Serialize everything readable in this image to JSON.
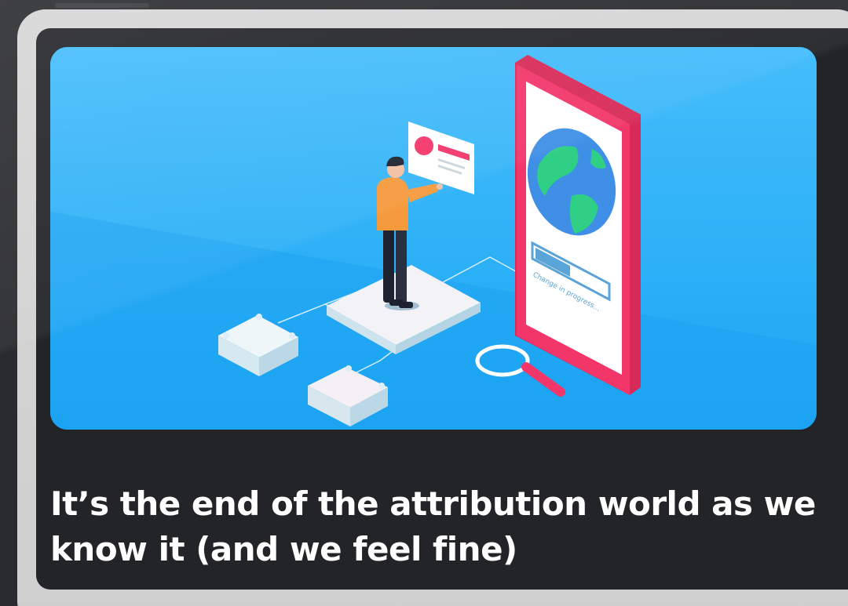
{
  "article": {
    "title": "It’s the end of the attribution world as we know it (and we feel fine)",
    "illustration": {
      "icon": "phone-globe-illustration",
      "progress_label": "Change in progress...",
      "progress": 0.45
    }
  },
  "colors": {
    "hero_bg": "#21aaf5",
    "card_bg": "#232428",
    "frame": "#d2d2d2",
    "phone_border": "#f2366a",
    "person_shirt": "#f59a3c",
    "text": "#ffffff"
  }
}
